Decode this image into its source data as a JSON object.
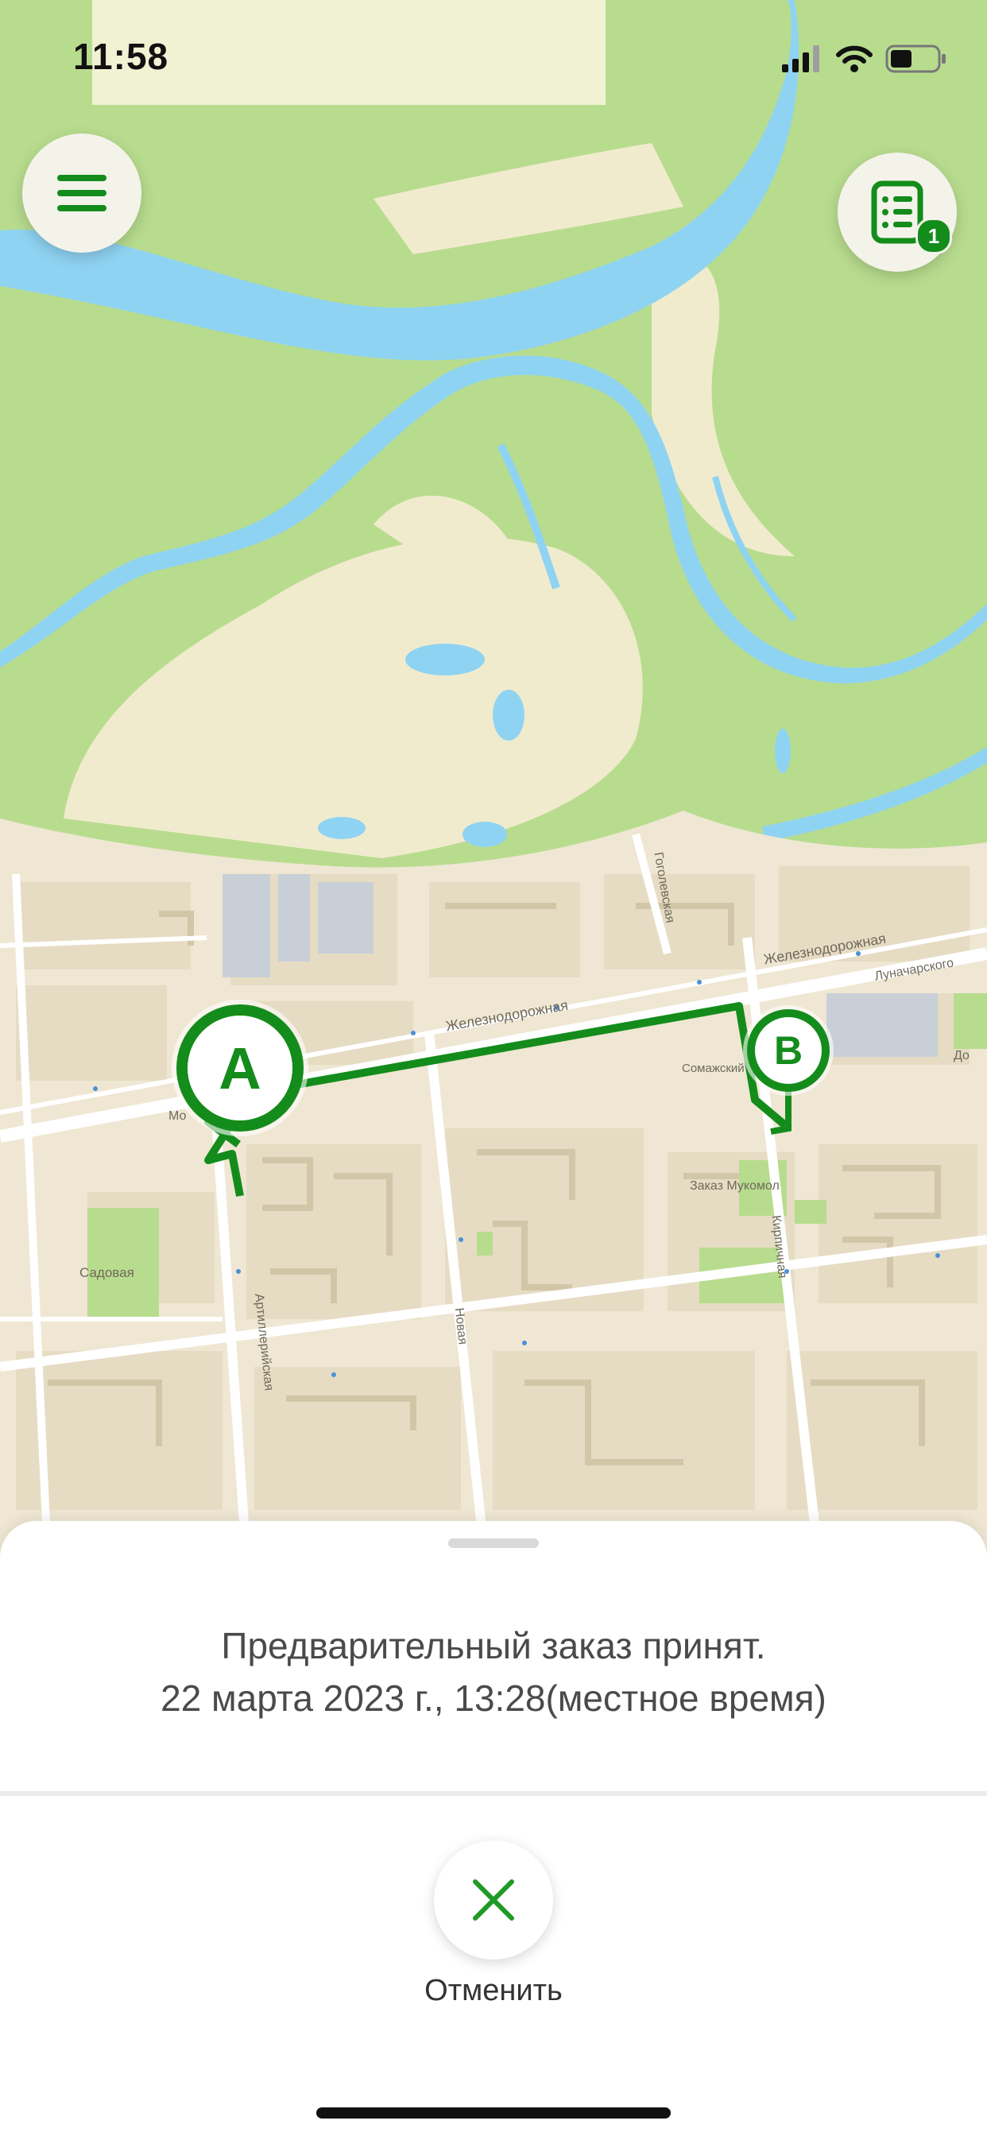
{
  "status_bar": {
    "time": "11:58",
    "signal_icon": "cellular-signal-icon",
    "wifi_icon": "wifi-icon",
    "battery_icon": "battery-icon"
  },
  "header": {
    "menu_icon": "hamburger-menu-icon",
    "orders_icon": "order-list-icon",
    "orders_badge": "1"
  },
  "map": {
    "markers": {
      "a_label": "A",
      "b_label": "B"
    },
    "labels": {
      "zheleznodorozhnaya": "Железнодорожная",
      "zheleznodorozhnaya2": "Железнодорожная",
      "gogolevskaya": "Гоголевская",
      "artilleriyskaya": "Артиллерийская",
      "novaya": "Новая",
      "kirpichnaya": "Кирпичная",
      "sadovaya": "Садовая",
      "lunacharskogo": "Луначарского",
      "zakaznik": "Заказ Мукомол",
      "smazeni": "Сомажский",
      "mo": "Мо",
      "do": "До"
    },
    "colors": {
      "route": "#148c1c",
      "water": "#8fd3f2",
      "green": "#b8dc8e",
      "sand": "#f1ebce",
      "city": "#efe7d3"
    }
  },
  "sheet": {
    "title": "Предварительный заказ принят.",
    "datetime": "22 марта 2023 г., 13:28(местное время)",
    "cancel_label": "Отменить",
    "cancel_icon": "close-x-icon"
  }
}
